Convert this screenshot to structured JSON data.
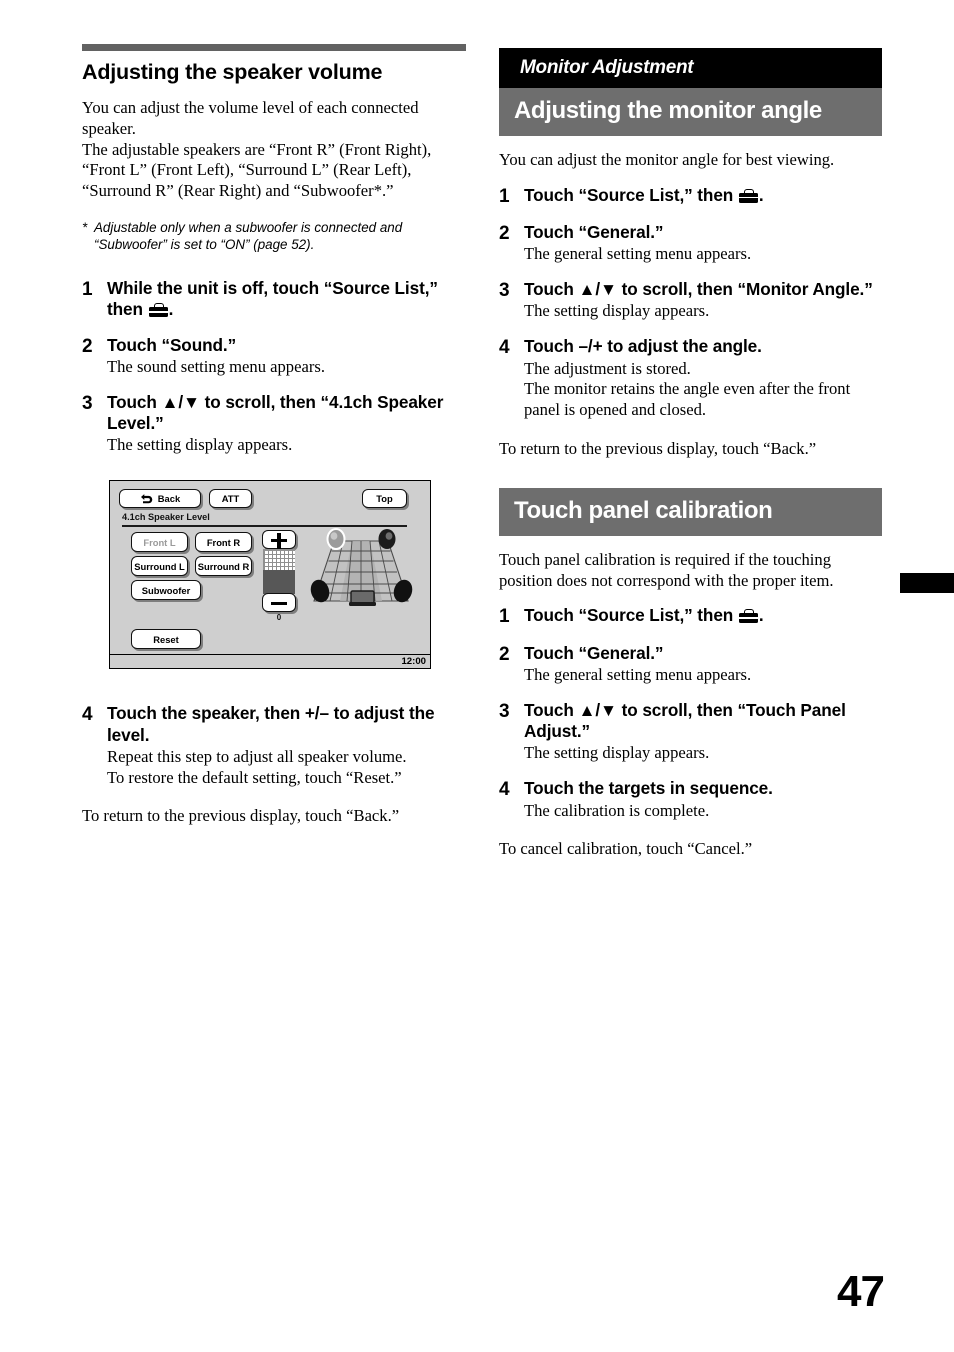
{
  "page": {
    "number": "47",
    "edge_tab_color": "#000000"
  },
  "left_column": {
    "section_title": "Adjusting the speaker volume",
    "intro": [
      "You can adjust the volume level of each connected speaker.",
      "The adjustable speakers are “Front R” (Front Right), “Front L” (Front Left), “Surround L” (Rear Left), “Surround R” (Rear Right) and “Subwoofer*.”"
    ],
    "footnote": {
      "mark": "*",
      "text": "Adjustable only when a subwoofer is connected and “Subwoofer” is set to “ON” (page 52)."
    },
    "steps": [
      {
        "num": "1",
        "head_before_icon": "While the unit is off, touch “Source List,” then ",
        "head_after_icon": ".",
        "sub": ""
      },
      {
        "num": "2",
        "head": "Touch “Sound.”",
        "sub": "The sound setting menu appears."
      },
      {
        "num": "3",
        "head": "Touch ▲/▼ to scroll, then “4.1ch Speaker Level.”",
        "sub": "The setting display appears."
      },
      {
        "num": "4",
        "head": "Touch the speaker, then +/– to adjust the level.",
        "sub": "Repeat this step to adjust all speaker volume.\nTo restore the default setting, touch “Reset.”"
      }
    ],
    "closing": "To return to the previous display, touch “Back.”"
  },
  "screen": {
    "back_button": "Back",
    "att_button": "ATT",
    "top_button": "Top",
    "title": "4.1ch Speaker Level",
    "speaker_buttons": [
      {
        "label": "Front L",
        "state": "dimmed"
      },
      {
        "label": "Front R",
        "state": "normal"
      },
      {
        "label": "Surround L",
        "state": "normal"
      },
      {
        "label": "Surround R",
        "state": "normal"
      },
      {
        "label": "Subwoofer",
        "state": "normal"
      }
    ],
    "reset_button": "Reset",
    "level_value": "0",
    "plus_label": "+",
    "minus_label": "–",
    "clock": "12:00"
  },
  "right_column": {
    "category_band": "Monitor Adjustment",
    "section_title": "Adjusting the monitor angle",
    "intro": "You can adjust the monitor angle for best viewing.",
    "steps": [
      {
        "num": "1",
        "head_before_icon": "Touch “Source List,” then ",
        "head_after_icon": ".",
        "sub": ""
      },
      {
        "num": "2",
        "head": "Touch “General.”",
        "sub": "The general setting menu appears."
      },
      {
        "num": "3",
        "head": "Touch ▲/▼ to scroll, then “Monitor Angle.”",
        "sub": "The setting display appears."
      },
      {
        "num": "4",
        "head": "Touch –/+ to adjust the angle.",
        "sub": "The adjustment is stored.\nThe monitor retains the angle even after the front panel is opened and closed."
      }
    ],
    "closing": "To return to the previous display, touch “Back.”",
    "second_section_title": "Touch panel calibration",
    "second_intro": "Touch panel calibration is required if the touching position does not correspond with the proper item.",
    "second_steps": [
      {
        "num": "1",
        "head_before_icon": "Touch “Source List,” then ",
        "head_after_icon": ".",
        "sub": ""
      },
      {
        "num": "2",
        "head": "Touch “General.”",
        "sub": "The general setting menu appears."
      },
      {
        "num": "3",
        "head": "Touch ▲/▼ to scroll, then “Touch Panel Adjust.”",
        "sub": "The setting display appears."
      },
      {
        "num": "4",
        "head": "Touch the targets in sequence.",
        "sub": "The calibration is complete."
      }
    ],
    "second_closing": "To cancel calibration, touch “Cancel.”"
  }
}
